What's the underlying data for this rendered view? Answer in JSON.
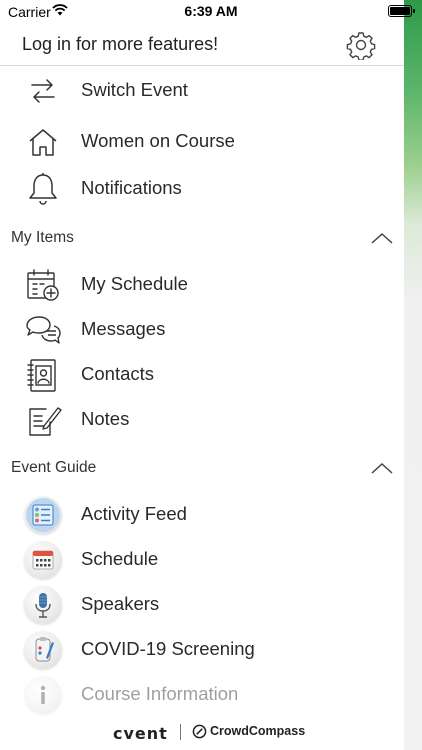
{
  "status_bar": {
    "carrier": "Carrier",
    "time": "6:39 AM"
  },
  "header": {
    "login_text": "Log in for more features!",
    "settings_icon": "gear-icon"
  },
  "top_items": [
    {
      "label": "Switch Event",
      "icon": "switch-arrows-icon"
    },
    {
      "label": "Women on Course",
      "icon": "home-icon"
    },
    {
      "label": "Notifications",
      "icon": "bell-icon"
    }
  ],
  "my_items": {
    "title": "My Items",
    "items": [
      {
        "label": "My Schedule",
        "icon": "calendar-add-icon"
      },
      {
        "label": "Messages",
        "icon": "chat-bubbles-icon"
      },
      {
        "label": "Contacts",
        "icon": "contacts-book-icon"
      },
      {
        "label": "Notes",
        "icon": "notes-pencil-icon"
      }
    ]
  },
  "event_guide": {
    "title": "Event Guide",
    "items": [
      {
        "label": "Activity Feed",
        "icon": "activity-feed-icon"
      },
      {
        "label": "Schedule",
        "icon": "schedule-calendar-icon"
      },
      {
        "label": "Speakers",
        "icon": "microphone-icon"
      },
      {
        "label": "COVID-19 Screening",
        "icon": "screening-icon"
      },
      {
        "label": "Course Information",
        "icon": "info-icon"
      }
    ]
  },
  "footer": {
    "brand": "cvent",
    "partner": "CrowdCompass"
  },
  "colors": {
    "accent_blue": "#3b7bc8",
    "edge_green": "#2e9a4a",
    "divider": "#d9d9d9"
  }
}
